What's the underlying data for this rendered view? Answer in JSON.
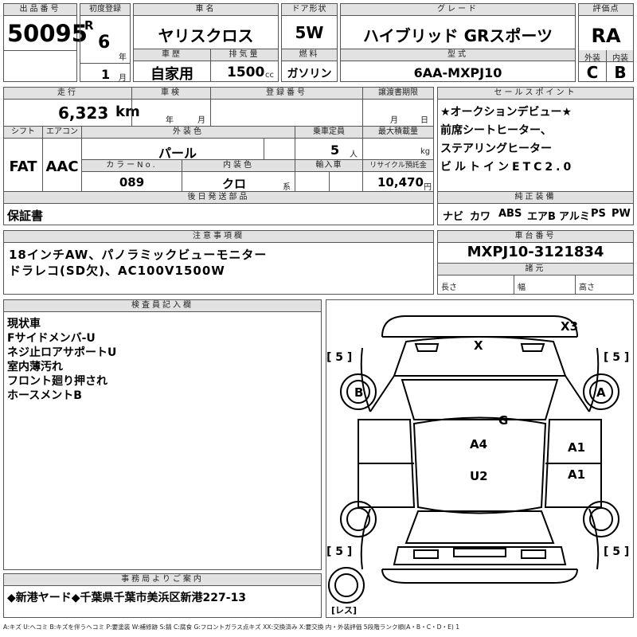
{
  "lot": {
    "header": "出品番号",
    "value": "50095"
  },
  "first_reg": {
    "header": "初度登録",
    "era": "R",
    "year": "6",
    "year_unit": "年",
    "month": "1",
    "month_unit": "月"
  },
  "model": {
    "header": "車名",
    "value": "ヤリスクロス"
  },
  "doors": {
    "header": "ドア形状",
    "value": "5W"
  },
  "grade": {
    "header": "グレード",
    "value": "ハイブリッド GRスポーツ"
  },
  "score": {
    "header": "評価点",
    "value": "RA",
    "ext_label": "外装",
    "int_label": "内装",
    "ext_value": "C",
    "int_value": "B"
  },
  "history": {
    "header": "車歴",
    "value": "自家用"
  },
  "displacement": {
    "header": "排気量",
    "value": "1500",
    "unit": "cc"
  },
  "fuel": {
    "header": "燃料",
    "value": "ガソリン"
  },
  "type_code": {
    "header": "型式",
    "value": "6AA-MXPJ10"
  },
  "mileage": {
    "header": "走行",
    "value": "6,323",
    "unit": "km"
  },
  "inspection": {
    "header": "車検",
    "year_unit": "年",
    "month_unit": "月"
  },
  "reg_number": {
    "header": "登録番号"
  },
  "transfer": {
    "header": "譲渡書期限",
    "month_unit": "月",
    "day_unit": "日"
  },
  "sales_points": {
    "header": "セールスポイント",
    "lines": [
      "★オークションデビュー★",
      "前席シートヒーター、",
      "ステアリングヒーター",
      "ビルトインETC2.0"
    ]
  },
  "shift": {
    "header": "シフト",
    "value": "FAT"
  },
  "aircon": {
    "header": "エアコン",
    "value": "AAC"
  },
  "ext_color": {
    "header": "外装色",
    "value": "パール"
  },
  "capacity": {
    "header": "乗車定員",
    "value": "5",
    "unit": "人"
  },
  "max_load": {
    "header": "最大積載量",
    "unit": "kg"
  },
  "color_no": {
    "header": "カラーNo.",
    "value": "089"
  },
  "int_color": {
    "header": "内装色",
    "value": "クロ",
    "unit": "系"
  },
  "import": {
    "header": "輸入車"
  },
  "recycle": {
    "header": "リサイクル預託金",
    "value": "10,470",
    "unit": "円"
  },
  "later_parts": {
    "header": "後日発送部品",
    "value": "保証書"
  },
  "equipment": {
    "header": "純正装備",
    "items": [
      "ナビ",
      "カワ",
      "ABS",
      "エアB",
      "アルミ",
      "PS",
      "PW"
    ]
  },
  "notes": {
    "header": "注意事項欄",
    "lines": [
      "18インチAW、パノラミックビューモニター",
      "ドラレコ(SD欠)、AC100V1500W"
    ]
  },
  "chassis": {
    "header": "車台番号",
    "value": "MXPJ10-3121834"
  },
  "dims": {
    "header": "諸元",
    "length": "長さ",
    "width": "幅",
    "height": "高さ"
  },
  "inspector": {
    "header": "検査員記入欄",
    "lines": [
      "現状車",
      "Fサイドメンバ-U",
      "ネジ止ロアサポートU",
      "室内薄汚れ",
      "フロント廻り押され",
      "ホースメントB"
    ]
  },
  "diagram": {
    "marks": {
      "x3": "X3",
      "x": "X",
      "b": "B",
      "a": "A",
      "g": "G",
      "a4": "A4",
      "a1_1": "A1",
      "u2": "U2",
      "a1_2": "A1"
    },
    "tires": {
      "fl": "[ 5 ]",
      "fr": "[ 5 ]",
      "rl": "[ 5 ]",
      "rr": "[ 5 ]",
      "spare": "[レス]"
    }
  },
  "office": {
    "header": "事務局よりご案内",
    "value": "◆新港ヤード◆千葉県千葉市美浜区新港227-13"
  },
  "legend": "A:キズ U:ヘコミ B:キズを伴うヘコミ P:要塗装 W:補修跡 S:錆 C:腐食 G:フロントガラス点キズ XX:交換済み X:要交換 内・外装評価 5段階ランク順(A・B・C・D・E) 1"
}
